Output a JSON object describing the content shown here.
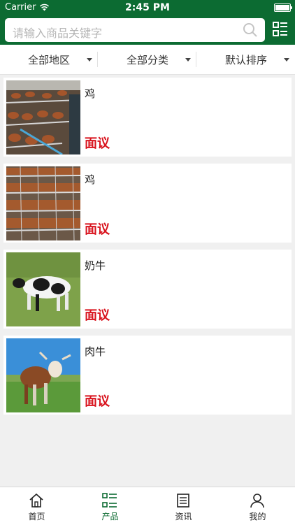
{
  "status": {
    "carrier": "Carrier",
    "time": "2:45 PM"
  },
  "search": {
    "placeholder": "请输入商品关键字"
  },
  "filters": [
    {
      "label": "全部地区"
    },
    {
      "label": "全部分类"
    },
    {
      "label": "默认排序"
    }
  ],
  "products": [
    {
      "title": "鸡",
      "price": "面议",
      "image": "chicken-coop-photo"
    },
    {
      "title": "鸡",
      "price": "面议",
      "image": "chicken-coop-photo"
    },
    {
      "title": "奶牛",
      "price": "面议",
      "image": "dairy-cow-photo"
    },
    {
      "title": "肉牛",
      "price": "面议",
      "image": "beef-cow-photo"
    }
  ],
  "tabs": [
    {
      "label": "首页",
      "icon": "home-icon"
    },
    {
      "label": "产品",
      "icon": "list-icon",
      "active": true
    },
    {
      "label": "资讯",
      "icon": "news-icon"
    },
    {
      "label": "我的",
      "icon": "user-icon"
    }
  ],
  "colors": {
    "brand": "#0c6b32",
    "price": "#d9141e",
    "background": "#f0f0f0"
  }
}
